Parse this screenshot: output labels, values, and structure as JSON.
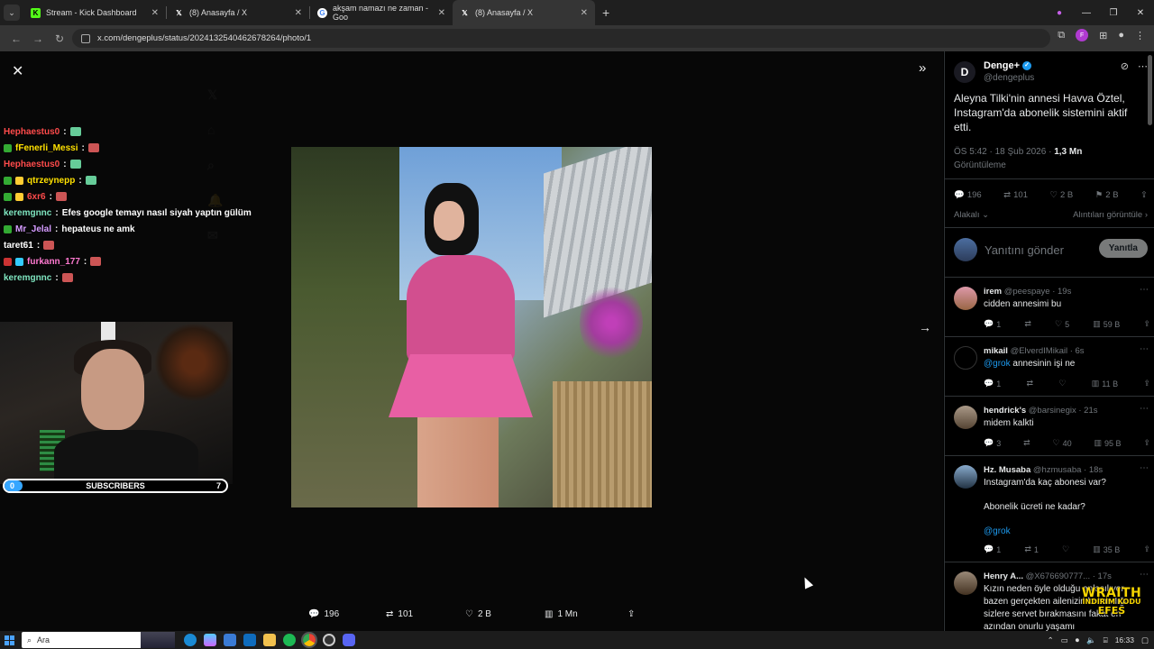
{
  "browser": {
    "tabs": [
      {
        "title": "Stream - Kick Dashboard",
        "icon": "kick-icon",
        "color": "#53fc18"
      },
      {
        "title": "(8) Anasayfa / X",
        "icon": "x-icon",
        "color": "#ffffff"
      },
      {
        "title": "akşam namazı ne zaman - Goo",
        "icon": "google-icon",
        "color": "#4285f4"
      },
      {
        "title": "(8) Anasayfa / X",
        "icon": "x-icon",
        "color": "#ffffff"
      }
    ],
    "active_tab": 3,
    "url": "x.com/dengeplus/status/2024132540462678264/photo/1"
  },
  "chat": [
    {
      "user": "Hephaestus0",
      "color": "#ff4b4b",
      "text": ""
    },
    {
      "user": "fFenerli_Messi",
      "color": "#ffe100",
      "text": ""
    },
    {
      "user": "Hephaestus0",
      "color": "#ff4b4b",
      "text": ""
    },
    {
      "user": "qtrzeynepp",
      "color": "#ffe100",
      "text": ""
    },
    {
      "user": "6xr6",
      "color": "#ff4b4b",
      "text": ""
    },
    {
      "user": "keremgnnc",
      "color": "#7fe6c0",
      "text": "Efes google temayı nasıl siyah yaptın gülüm"
    },
    {
      "user": "Mr_Jelal",
      "color": "#d59bff",
      "text": "hepateus ne amk"
    },
    {
      "user": "taret61",
      "color": "#ffffff",
      "text": ""
    },
    {
      "user": "furkann_177",
      "color": "#ff7ad1",
      "text": ""
    },
    {
      "user": "keremgnnc",
      "color": "#7fe6c0",
      "text": ""
    }
  ],
  "subscribers": {
    "label": "SUBSCRIBERS",
    "current": "0",
    "goal": "7",
    "progress": 0.04
  },
  "photo_actions": {
    "replies": "196",
    "reposts": "101",
    "likes": "2 B",
    "views": "1 Mn"
  },
  "post": {
    "name": "Denge+",
    "handle": "@dengeplus",
    "text": "Aleyna Tilki'nin annesi Havva Öztel, Instagram'da abonelik sistemini aktif etti.",
    "time": "ÖS 5:42 · 18 Şub 2026 ·",
    "views": "1,3 Mn",
    "views_label": "Görüntüleme",
    "stats": {
      "replies": "196",
      "reposts": "101",
      "likes": "2 B",
      "bookmarks": "2 B"
    },
    "related": "Alakalı",
    "quotes": "Alıntıları görüntüle",
    "reply_placeholder": "Yanıtını gönder",
    "reply_button": "Yanıtla"
  },
  "comments": [
    {
      "name": "irem",
      "handle": "@peespaye · 19s",
      "body": "cidden annesimi bu",
      "replies": "1",
      "reposts": "",
      "likes": "5",
      "views": "59 B"
    },
    {
      "name": "mikail",
      "handle": "@ElverdIMikail · 6s",
      "mention": "@grok",
      "body": "annesinin işi ne",
      "replies": "1",
      "reposts": "",
      "likes": "",
      "views": "11 B"
    },
    {
      "name": "hendrick's",
      "handle": "@barsinegix · 21s",
      "body": "midem kalkti",
      "replies": "3",
      "reposts": "",
      "likes": "40",
      "views": "95 B"
    },
    {
      "name": "Hz. Musaba",
      "handle": "@hzmusaba · 18s",
      "body": "Instagram'da kaç abonesi var?",
      "body2": "Abonelik ücreti ne kadar?",
      "mention": "@grok",
      "replies": "1",
      "reposts": "1",
      "likes": "",
      "views": "35 B"
    },
    {
      "name": "Henry A...",
      "handle": "@X676690777... · 17s",
      "body": "Kızın neden öyle olduğu anlaşılıyor bazen gerçekten ailenizin kazandığı sizlere servet bırakmasını fakat en azından onurlu yaşamı"
    }
  ],
  "watermark": {
    "line1": "WRAITH",
    "line2": "İNDİRİM KODU",
    "line3": "EFES"
  },
  "taskbar": {
    "search": "Ara",
    "time": "16:33"
  }
}
